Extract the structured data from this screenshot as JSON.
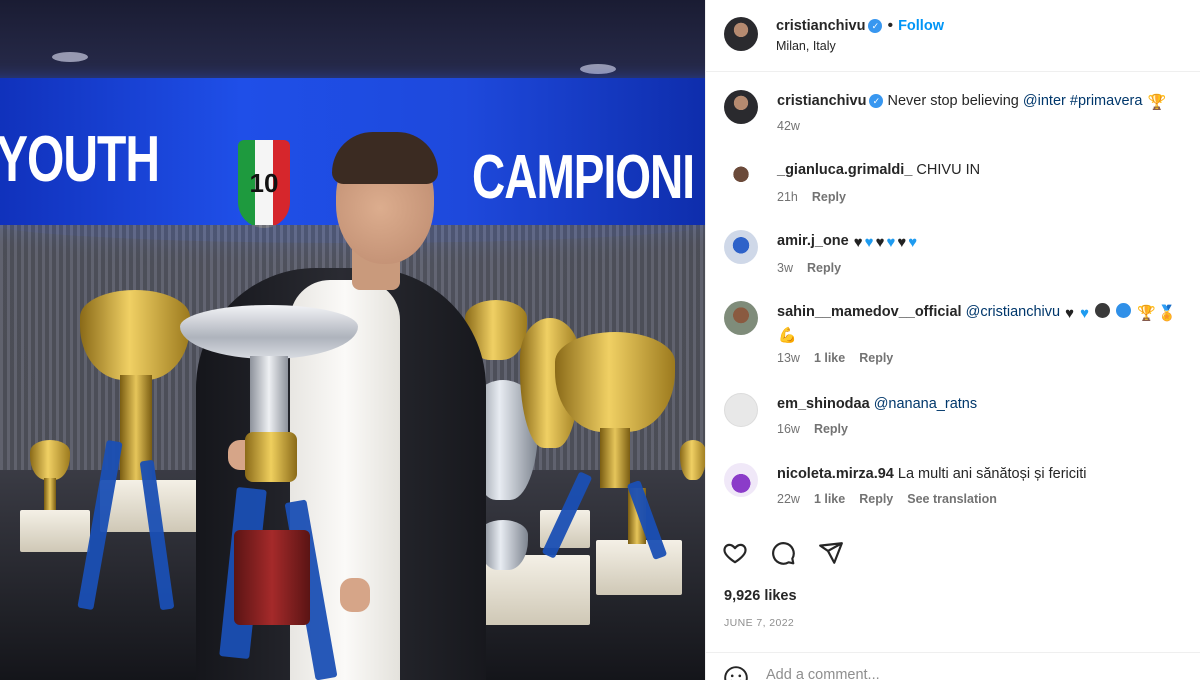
{
  "photo": {
    "led_left_text": "YOUTH",
    "led_right_text": "CAMPIONI",
    "shield_number": "10"
  },
  "header": {
    "username": "cristianchivu",
    "separator": "•",
    "follow_label": "Follow",
    "location": "Milan, Italy"
  },
  "caption": {
    "username": "cristianchivu",
    "text": "Never stop believing ",
    "mention": "@inter",
    "hashtag": "#primavera",
    "time": "42w"
  },
  "comments": [
    {
      "username": "_gianluca.grimaldi_",
      "text": "CHIVU IN",
      "time": "21h",
      "reply": "Reply"
    },
    {
      "username": "amir.j_one",
      "text": "",
      "time": "3w",
      "reply": "Reply",
      "emojis": [
        "black-heart",
        "blue-heart",
        "black-heart",
        "blue-heart",
        "black-heart",
        "blue-heart"
      ]
    },
    {
      "username": "sahin__mamedov__official",
      "mention": "@cristianchivu",
      "time": "13w",
      "likes": "1 like",
      "reply": "Reply",
      "emojis": [
        "black-heart",
        "blue-heart",
        "black-circle",
        "blue-circle",
        "trophy",
        "medal",
        "muscle"
      ]
    },
    {
      "username": "em_shinodaa",
      "mention": "@nanana_ratns",
      "time": "16w",
      "reply": "Reply"
    },
    {
      "username": "nicoleta.mirza.94",
      "text": "La multi ani sănătoși și fericiti",
      "time": "22w",
      "likes": "1 like",
      "reply": "Reply",
      "translation": "See translation"
    }
  ],
  "likes": "9,926 likes",
  "date": "JUNE 7, 2022",
  "add_comment": {
    "placeholder": "Add a comment..."
  },
  "colors": {
    "accent": "#0095f6",
    "verified": "#3897f0",
    "mention": "#00376b",
    "led": "#1f4fe8"
  },
  "icons": [
    "heart-icon",
    "comment-icon",
    "share-icon",
    "emoji-icon",
    "verified-icon"
  ]
}
